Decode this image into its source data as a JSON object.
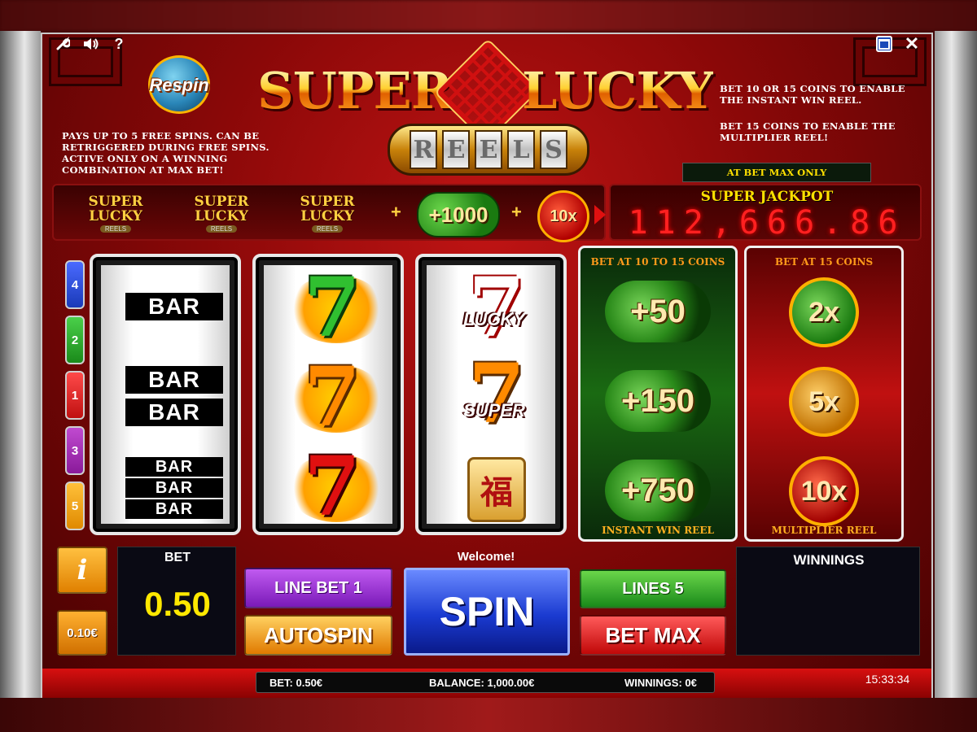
{
  "toolbar": {
    "settings_icon": "wrench-icon",
    "sound_icon": "speaker-icon",
    "help_label": "?",
    "maximize_icon": "maximize-icon",
    "close_label": "✕"
  },
  "respin": {
    "label": "Respin",
    "description": "PAYS UP TO 5 FREE SPINS. CAN BE RETRIGGERED DURING FREE SPINS. ACTIVE ONLY ON A WINNING COMBINATION AT MAX BET!"
  },
  "logo": {
    "word1": "SUPER",
    "word2": "LUCKY",
    "reels_letters": [
      "R",
      "E",
      "E",
      "L",
      "S"
    ]
  },
  "bet_info": {
    "line1": "BET 10 OR 15 COINS TO ENABLE THE INSTANT WIN REEL.",
    "line2": "BET 15 COINS TO ENABLE THE MULTIPLIER REEL!",
    "max_only": "AT BET MAX ONLY"
  },
  "jackpot_combo": {
    "logo_word1": "SUPER",
    "logo_word2": "LUCKY",
    "logo_reels": "REELS",
    "plus": "+",
    "coin_value": "+1000",
    "multiplier": "10x"
  },
  "jackpot": {
    "title": "SUPER JACKPOT",
    "value": "112,666.86"
  },
  "line_indicators": [
    {
      "label": "4",
      "color": "#1a3ab8"
    },
    {
      "label": "2",
      "color": "#1a8a1a"
    },
    {
      "label": "1",
      "color": "#c01010"
    },
    {
      "label": "3",
      "color": "#8a1a9a"
    },
    {
      "label": "5",
      "color": "#e08a00"
    }
  ],
  "reels": {
    "reel1": {
      "bar_single": "BAR",
      "bar_double": [
        "BAR",
        "BAR"
      ],
      "bar_triple": [
        "BAR",
        "BAR",
        "BAR"
      ]
    },
    "reel2": {
      "sevens": [
        "7",
        "7",
        "7"
      ]
    },
    "reel3": {
      "seven_lucky": "7",
      "lucky_label": "LUCKY",
      "seven_super": "7",
      "super_label": "SUPER",
      "fu_symbol": "福"
    }
  },
  "instant_win_reel": {
    "title": "BET AT 10 TO 15 COINS",
    "values": [
      "+50",
      "+150",
      "+750"
    ],
    "footer": "INSTANT WIN REEL"
  },
  "multiplier_reel": {
    "title": "BET AT 15 COINS",
    "values": [
      "2x",
      "5x",
      "10x"
    ],
    "footer": "MULTIPLIER REEL"
  },
  "controls": {
    "info_label": "i",
    "coin_value": "0.10€",
    "bet_label": "BET",
    "bet_value": "0.50",
    "welcome": "Welcome!",
    "line_bet_label": "LINE BET 1",
    "autospin_label": "AUTOSPIN",
    "spin_label": "SPIN",
    "lines_label": "LINES 5",
    "bet_max_label": "BET MAX",
    "winnings_label": "WINNINGS"
  },
  "status": {
    "bet": "BET: 0.50€",
    "balance": "BALANCE: 1,000.00€",
    "winnings": "WINNINGS: 0€",
    "time": "15:33:34"
  }
}
